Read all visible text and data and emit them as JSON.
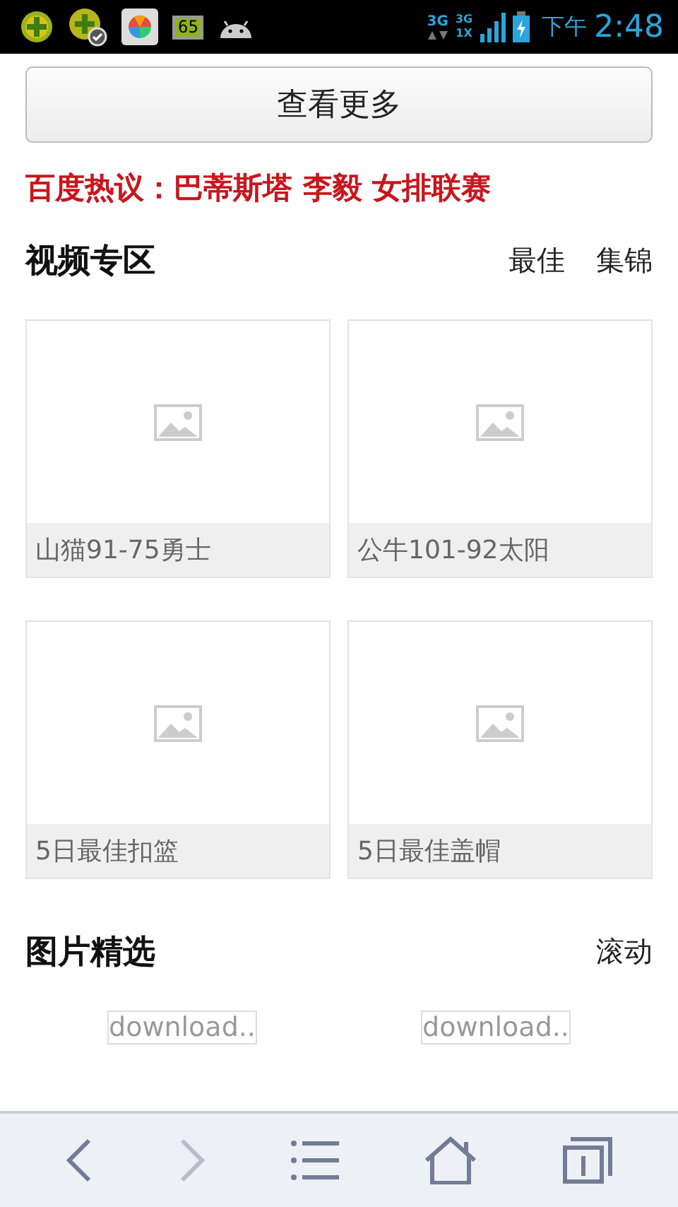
{
  "status_bar": {
    "battery_badge": "65",
    "network_label": "3G",
    "signal_labels": [
      "3G",
      "1X"
    ],
    "period": "下午",
    "time": "2:48"
  },
  "more_button": "查看更多",
  "hot_topics": "百度热议：巴蒂斯塔 李毅 女排联赛",
  "video_section": {
    "title": "视频专区",
    "links": [
      "最佳",
      "集锦"
    ],
    "videos": [
      {
        "caption": "山猫91-75勇士"
      },
      {
        "caption": "公牛101-92太阳"
      },
      {
        "caption": "5日最佳扣篮"
      },
      {
        "caption": "5日最佳盖帽"
      }
    ]
  },
  "photo_section": {
    "title": "图片精选",
    "links": [
      "滚动"
    ],
    "placeholders": [
      "download..",
      "download.."
    ]
  },
  "toolbar": [
    {
      "kind": "back",
      "disabled": false
    },
    {
      "kind": "forward",
      "disabled": true
    },
    {
      "kind": "menu",
      "disabled": false
    },
    {
      "kind": "home",
      "disabled": false
    },
    {
      "kind": "tabs",
      "disabled": false
    }
  ]
}
